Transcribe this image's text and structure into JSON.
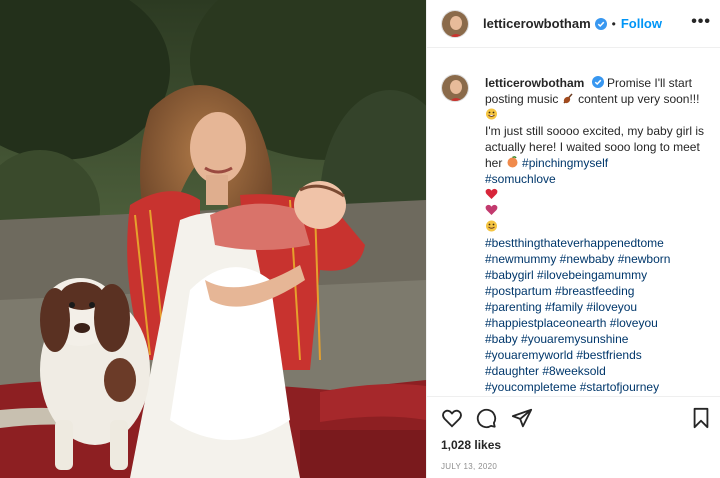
{
  "post": {
    "username": "letticerowbotham",
    "follow_label": "Follow",
    "separator": "•",
    "more_label": "•••",
    "caption": {
      "username": "letticerowbotham",
      "line1": "Promise I'll start posting music",
      "line1b": "content up very soon!!!",
      "body": "I'm just still soooo excited, my baby girl is actually here! I waited sooo long to meet her",
      "inline_tag": "#pinchingmyself",
      "tags_top": [
        "#somuchlove"
      ],
      "hashtags": [
        "#bestthingthateverhappenedtome",
        "#newmummy #newbaby #newborn",
        "#babygirl #ilovebeingamummy",
        "#postpartum #breastfeeding",
        "#parenting #family #iloveyou",
        "#happiestplaceonearth #loveyou",
        "#baby #youaremysunshine",
        "#youaremyworld #bestfriends",
        "#daughter #8weeksold",
        "#youcompleteme #startofjourney"
      ]
    },
    "likes": "1,028 likes",
    "date": "JULY 13, 2020"
  },
  "icons": {
    "verified": "verified-badge-icon",
    "like": "heart-icon",
    "comment": "comment-icon",
    "share": "paper-plane-icon",
    "save": "bookmark-icon",
    "violin": "violin-icon",
    "grin": "grinning-face-icon",
    "peach": "peach-icon"
  },
  "colors": {
    "link": "#00376b",
    "follow": "#0095f6",
    "verified": "#3897f0",
    "heart_red": "#d8253a",
    "date_gray": "#8e8e8e"
  }
}
